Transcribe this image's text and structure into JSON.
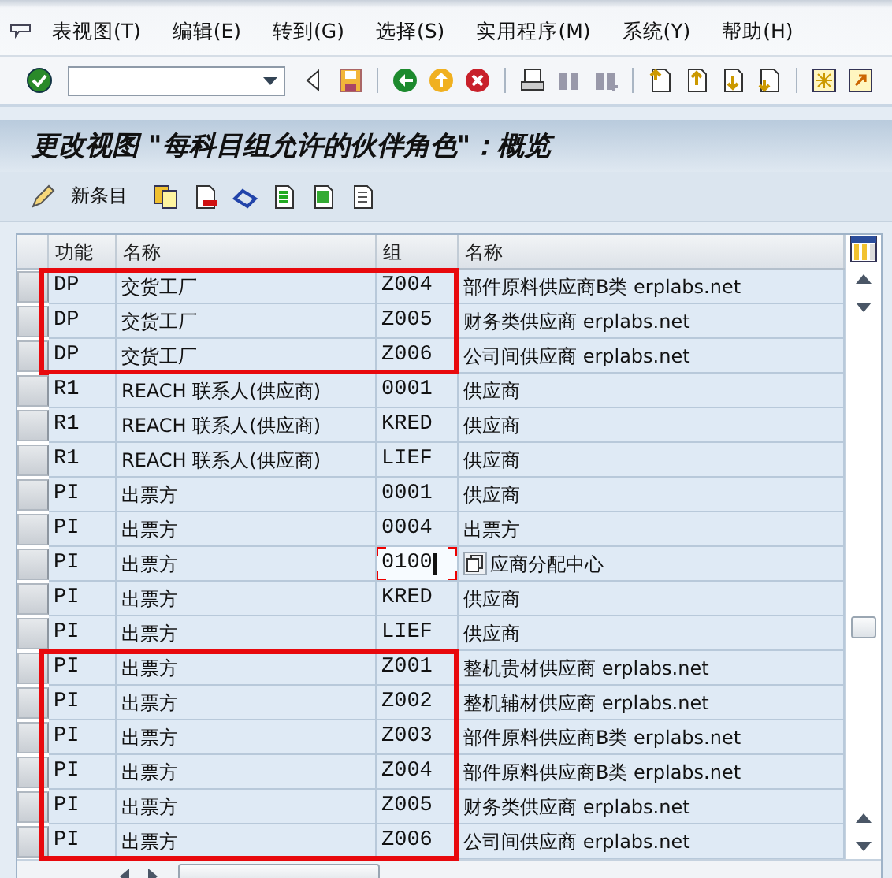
{
  "menu": [
    {
      "label": "表视图(T)"
    },
    {
      "label": "编辑(E)"
    },
    {
      "label": "转到(G)"
    },
    {
      "label": "选择(S)"
    },
    {
      "label": "实用程序(M)"
    },
    {
      "label": "系统(Y)"
    },
    {
      "label": "帮助(H)"
    }
  ],
  "title": "更改视图 \"每科目组允许的伙伴角色\"：概览",
  "app_toolbar": {
    "new_entries": "新条目"
  },
  "table": {
    "columns": [
      "功能",
      "名称",
      "组",
      "名称"
    ],
    "groups": [
      {
        "highlighted": true,
        "rows": [
          {
            "cells": [
              "DP",
              "交货工厂",
              "Z004",
              "部件原料供应商B类 erplabs.net"
            ],
            "focused": false
          },
          {
            "cells": [
              "DP",
              "交货工厂",
              "Z005",
              "财务类供应商 erplabs.net"
            ],
            "focused": false
          },
          {
            "cells": [
              "DP",
              "交货工厂",
              "Z006",
              "公司间供应商 erplabs.net"
            ],
            "focused": false
          }
        ]
      },
      {
        "highlighted": false,
        "rows": [
          {
            "cells": [
              "R1",
              "REACH 联系人(供应商)",
              "0001",
              "供应商"
            ],
            "focused": false
          },
          {
            "cells": [
              "R1",
              "REACH 联系人(供应商)",
              "KRED",
              "供应商"
            ],
            "focused": false
          },
          {
            "cells": [
              "R1",
              "REACH 联系人(供应商)",
              "LIEF",
              "供应商"
            ],
            "focused": false
          },
          {
            "cells": [
              "PI",
              "出票方",
              "0001",
              "供应商"
            ],
            "focused": false
          },
          {
            "cells": [
              "PI",
              "出票方",
              "0004",
              "出票方"
            ],
            "focused": false
          },
          {
            "cells": [
              "PI",
              "出票方",
              "0100",
              "应商分配中心"
            ],
            "focused": true
          },
          {
            "cells": [
              "PI",
              "出票方",
              "KRED",
              "供应商"
            ],
            "focused": false
          },
          {
            "cells": [
              "PI",
              "出票方",
              "LIEF",
              "供应商"
            ],
            "focused": false
          }
        ]
      },
      {
        "highlighted": true,
        "rows": [
          {
            "cells": [
              "PI",
              "出票方",
              "Z001",
              "整机贵材供应商 erplabs.net"
            ],
            "focused": false
          },
          {
            "cells": [
              "PI",
              "出票方",
              "Z002",
              "整机辅材供应商 erplabs.net"
            ],
            "focused": false
          },
          {
            "cells": [
              "PI",
              "出票方",
              "Z003",
              "部件原料供应商B类 erplabs.net"
            ],
            "focused": false
          },
          {
            "cells": [
              "PI",
              "出票方",
              "Z004",
              "部件原料供应商B类 erplabs.net"
            ],
            "focused": false
          },
          {
            "cells": [
              "PI",
              "出票方",
              "Z005",
              "财务类供应商 erplabs.net"
            ],
            "focused": false
          },
          {
            "cells": [
              "PI",
              "出票方",
              "Z006",
              "公司间供应商 erplabs.net"
            ],
            "focused": false
          }
        ]
      }
    ]
  }
}
